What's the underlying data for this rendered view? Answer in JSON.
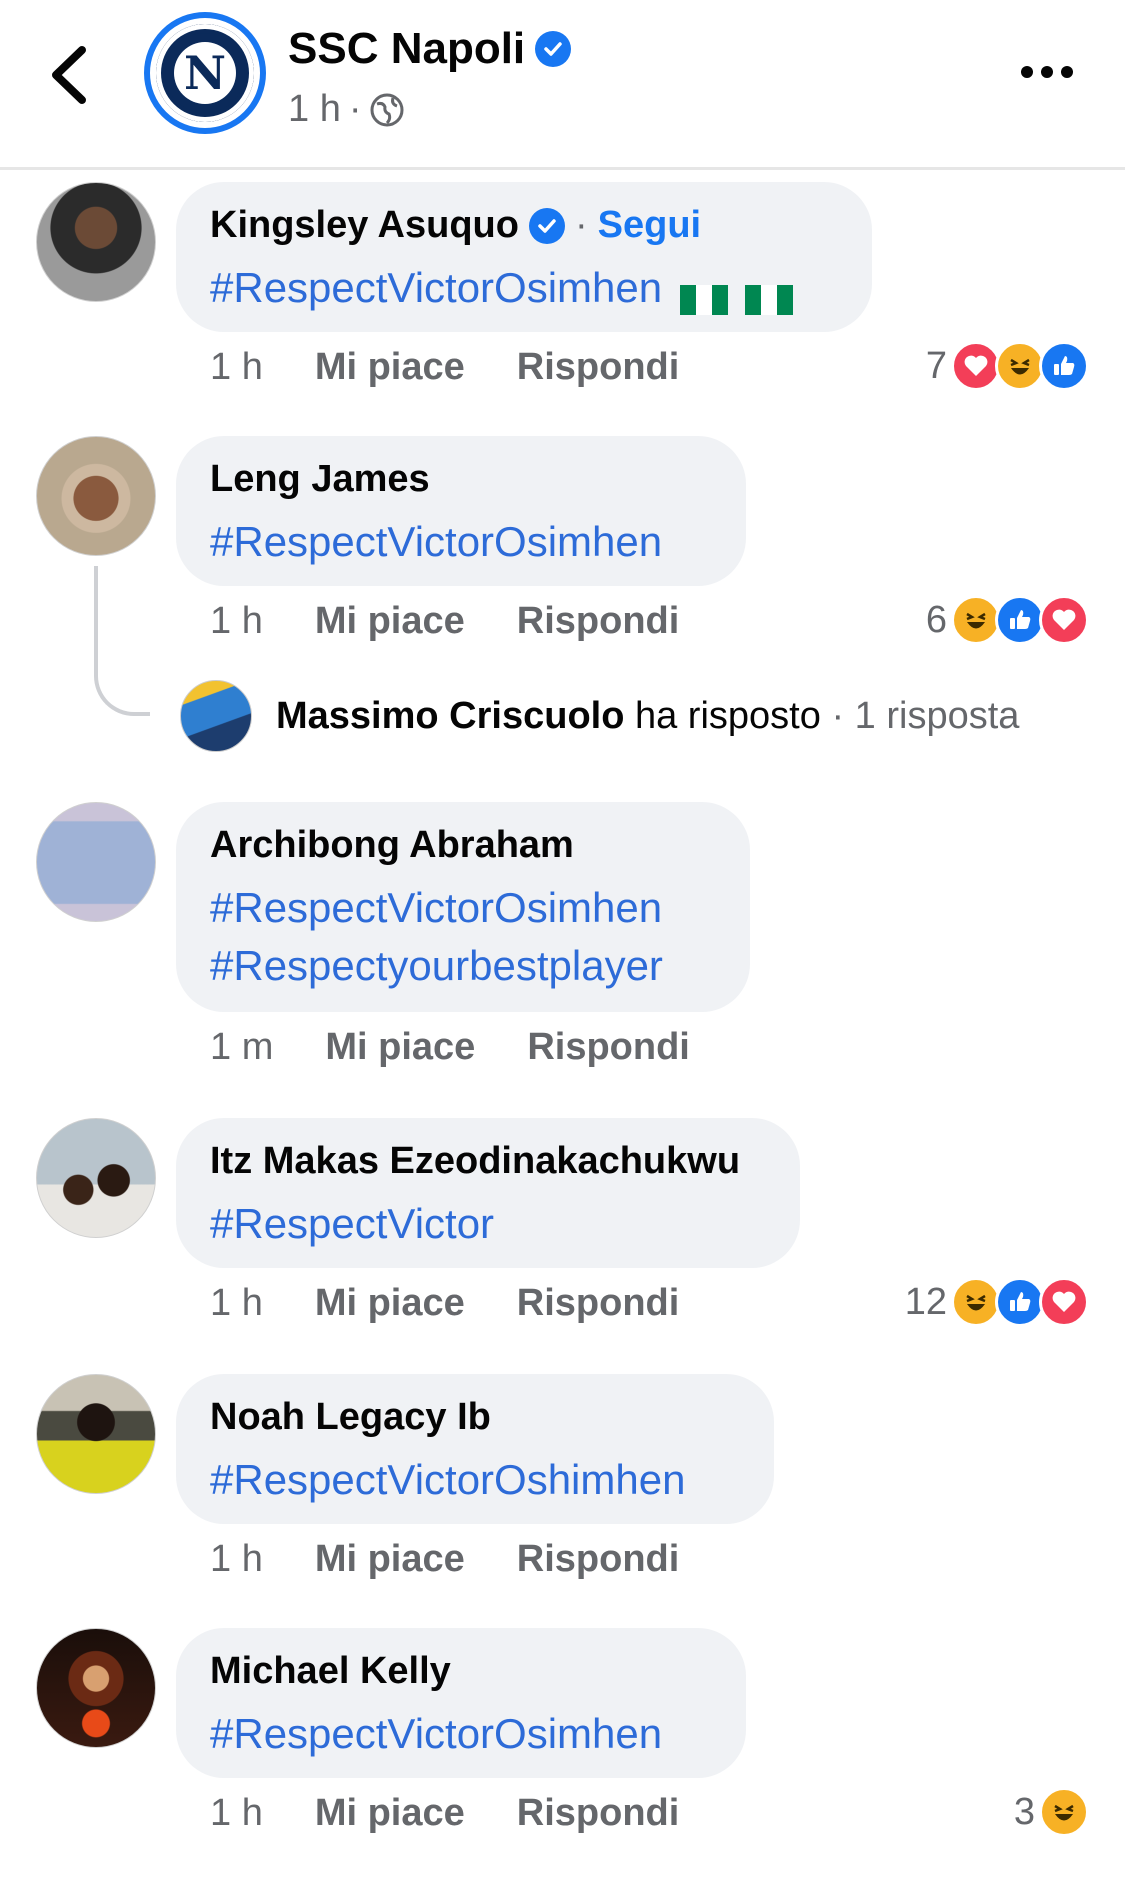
{
  "header": {
    "page_name": "SSC Napoli",
    "time": "1 h",
    "separator": "·",
    "logo_letter": "N"
  },
  "colors": {
    "brand_blue": "#1877f2",
    "hashtag_blue": "#2d6bd8",
    "meta_gray": "#65676b",
    "bubble_bg": "#f0f2f5"
  },
  "comments": [
    {
      "author": "Kingsley Asuquo",
      "verified": true,
      "follow_label": "Segui",
      "dot": "·",
      "text": "#RespectVictorOsimhen",
      "flags": 2,
      "time": "1 h",
      "like_label": "Mi piace",
      "reply_label": "Rispondi",
      "reaction_count": "7",
      "reactions": [
        "love",
        "haha",
        "like"
      ]
    },
    {
      "author": "Leng James",
      "text": "#RespectVictorOsimhen",
      "time": "1 h",
      "like_label": "Mi piace",
      "reply_label": "Rispondi",
      "reaction_count": "6",
      "reactions": [
        "haha",
        "like",
        "love"
      ],
      "reply_summary": {
        "name": "Massimo Criscuolo",
        "action": "ha risposto",
        "count": "· 1 risposta"
      }
    },
    {
      "author": "Archibong Abraham",
      "text_line1": "#RespectVictorOsimhen",
      "text_line2": "#Respectyourbestplayer",
      "time": "1 m",
      "like_label": "Mi piace",
      "reply_label": "Rispondi"
    },
    {
      "author": "Itz Makas Ezeodinakachukwu",
      "text": "#RespectVictor",
      "time": "1 h",
      "like_label": "Mi piace",
      "reply_label": "Rispondi",
      "reaction_count": "12",
      "reactions": [
        "haha",
        "like",
        "love"
      ]
    },
    {
      "author": "Noah Legacy Ib",
      "text": "#RespectVictorOshimhen",
      "time": "1 h",
      "like_label": "Mi piace",
      "reply_label": "Rispondi"
    },
    {
      "author": "Michael Kelly",
      "text": "#RespectVictorOsimhen",
      "time": "1 h",
      "like_label": "Mi piace",
      "reply_label": "Rispondi",
      "reaction_count": "3",
      "reactions": [
        "haha"
      ]
    }
  ]
}
